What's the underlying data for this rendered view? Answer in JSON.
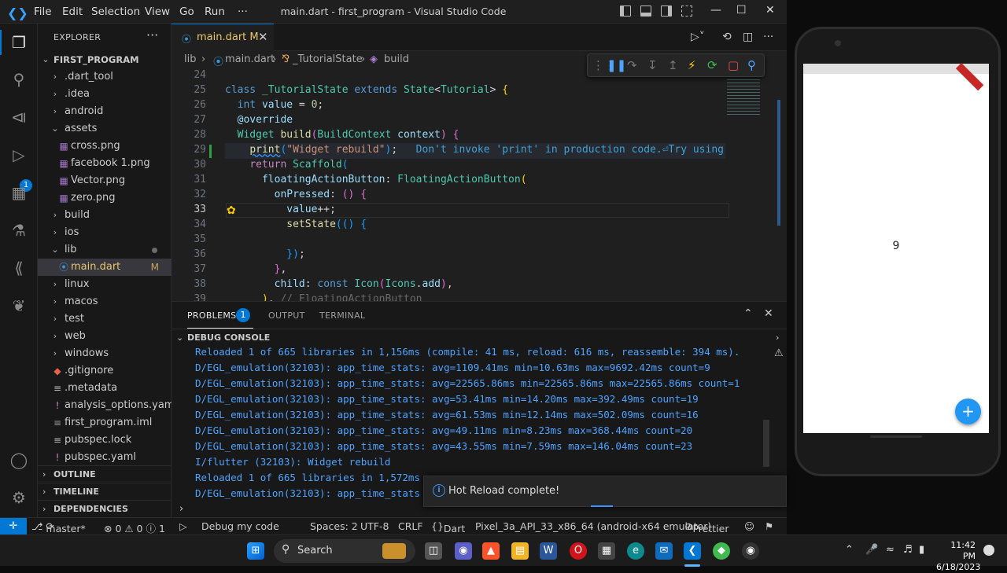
{
  "window": {
    "title": "main.dart - first_program - Visual Studio Code"
  },
  "menu": [
    "File",
    "Edit",
    "Selection",
    "View",
    "Go",
    "Run",
    "···"
  ],
  "sidebar": {
    "header": "EXPLORER",
    "project": "FIRST_PROGRAM",
    "items": [
      {
        "label": ".dart_tool",
        "kind": "folder",
        "depth": 1,
        "open": false
      },
      {
        "label": ".idea",
        "kind": "folder",
        "depth": 1,
        "open": false
      },
      {
        "label": "android",
        "kind": "folder",
        "depth": 1,
        "open": false
      },
      {
        "label": "assets",
        "kind": "folder",
        "depth": 1,
        "open": true
      },
      {
        "label": "cross.png",
        "kind": "image",
        "depth": 2
      },
      {
        "label": "facebook 1.png",
        "kind": "image",
        "depth": 2
      },
      {
        "label": "Vector.png",
        "kind": "image",
        "depth": 2
      },
      {
        "label": "zero.png",
        "kind": "image",
        "depth": 2
      },
      {
        "label": "build",
        "kind": "folder",
        "depth": 1,
        "open": false
      },
      {
        "label": "ios",
        "kind": "folder",
        "depth": 1,
        "open": false
      },
      {
        "label": "lib",
        "kind": "folder",
        "depth": 1,
        "open": true
      },
      {
        "label": "main.dart",
        "kind": "dart",
        "depth": 2,
        "flag": "M"
      },
      {
        "label": "linux",
        "kind": "folder",
        "depth": 1,
        "open": false
      },
      {
        "label": "macos",
        "kind": "folder",
        "depth": 1,
        "open": false
      },
      {
        "label": "test",
        "kind": "folder",
        "depth": 1,
        "open": false
      },
      {
        "label": "web",
        "kind": "folder",
        "depth": 1,
        "open": false
      },
      {
        "label": "windows",
        "kind": "folder",
        "depth": 1,
        "open": false
      },
      {
        "label": ".gitignore",
        "kind": "git",
        "depth": 1
      },
      {
        "label": ".metadata",
        "kind": "meta",
        "depth": 1
      },
      {
        "label": "analysis_options.yaml",
        "kind": "yaml",
        "depth": 1
      },
      {
        "label": "first_program.iml",
        "kind": "iml",
        "depth": 1
      },
      {
        "label": "pubspec.lock",
        "kind": "lock",
        "depth": 1
      },
      {
        "label": "pubspec.yaml",
        "kind": "yaml",
        "depth": 1
      }
    ],
    "sections": [
      "OUTLINE",
      "TIMELINE",
      "DEPENDENCIES"
    ]
  },
  "editor": {
    "tab": {
      "name": "main.dart",
      "flag": "M"
    },
    "breadcrumbs": [
      "lib",
      "main.dart",
      "_TutorialState",
      "build"
    ],
    "lines": [
      24,
      25,
      26,
      27,
      28,
      29,
      30,
      31,
      32,
      33,
      34,
      35,
      36,
      37,
      38,
      39
    ],
    "current_line": 33,
    "inline_hint": "Don't invoke 'print' in production code.⏎Try using"
  },
  "panel": {
    "tabs": [
      "PROBLEMS",
      "OUTPUT",
      "TERMINAL"
    ],
    "problems_count": "1",
    "console_header": "DEBUG CONSOLE",
    "logs": [
      "Reloaded 1 of 665 libraries in 1,156ms (compile: 41 ms, reload: 616 ms, reassemble: 394 ms).",
      "D/EGL_emulation(32103): app_time_stats: avg=1109.41ms min=10.63ms max=9692.42ms count=9",
      "D/EGL_emulation(32103): app_time_stats: avg=22565.86ms min=22565.86ms max=22565.86ms count=1",
      "D/EGL_emulation(32103): app_time_stats: avg=53.41ms min=14.20ms max=392.49ms count=19",
      "D/EGL_emulation(32103): app_time_stats: avg=61.53ms min=12.14ms max=502.09ms count=16",
      "D/EGL_emulation(32103): app_time_stats: avg=49.11ms min=8.23ms max=368.44ms count=20",
      "D/EGL_emulation(32103): app_time_stats: avg=43.55ms min=7.59ms max=146.04ms count=23",
      "I/flutter (32103): Widget rebuild",
      "Reloaded 1 of 665 libraries in 1,572ms",
      "D/EGL_emulation(32103): app_time_stats"
    ],
    "toast": "Hot Reload complete!"
  },
  "status": {
    "branch": "master*",
    "problems": "⊗ 0 ⚠ 0 ⓘ 1",
    "debug": "Debug my code",
    "spaces": "Spaces: 2",
    "encoding": "UTF-8",
    "eol": "CRLF",
    "language": "Dart",
    "device": "Pixel_3a_API_33_x86_64 (android-x64 emulator)",
    "formatter": "Prettier"
  },
  "emulator": {
    "counter": "9",
    "fab": "+"
  },
  "taskbar": {
    "search_placeholder": "Search",
    "time": "11:42 PM",
    "date": "6/18/2023"
  },
  "colors": {
    "accent": "#0078d4",
    "fab": "#2196f3",
    "log": "#4fa3ff"
  }
}
